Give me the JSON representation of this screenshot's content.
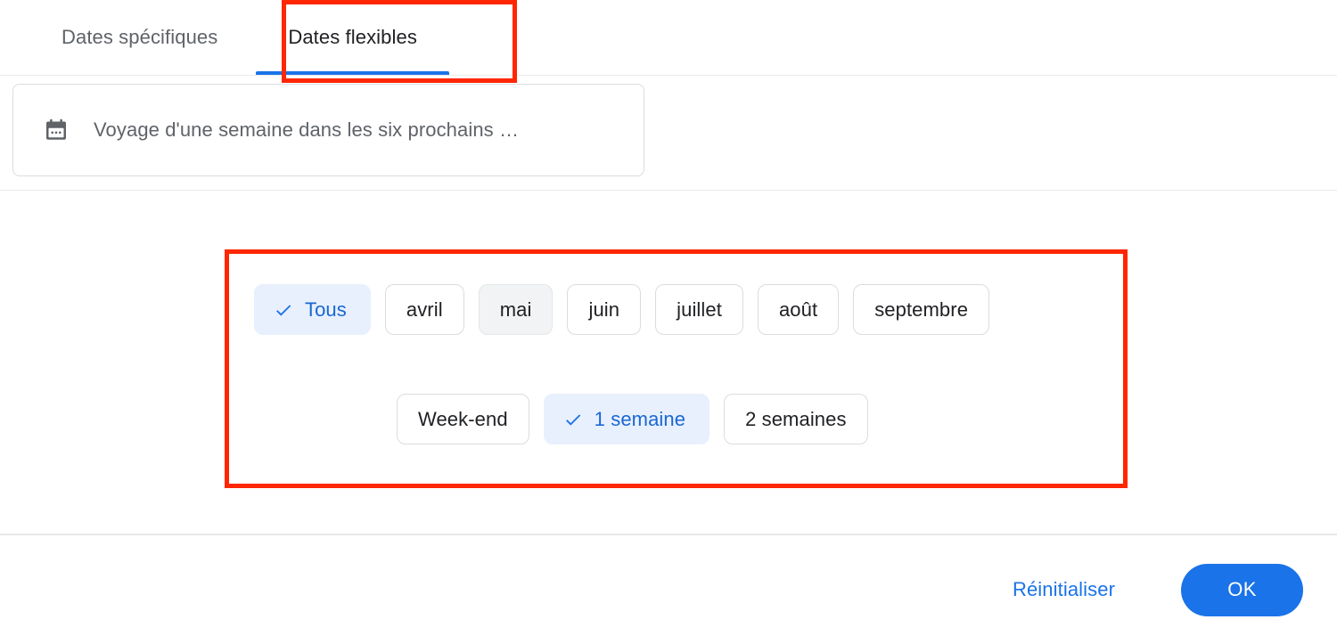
{
  "tabs": [
    {
      "label": "Dates spécifiques",
      "active": false
    },
    {
      "label": "Dates flexibles",
      "active": true
    }
  ],
  "search_field": {
    "icon": "calendar-icon",
    "value": "Voyage d'une semaine dans les six prochains …"
  },
  "options": {
    "months": [
      {
        "label": "Tous",
        "state": "selected"
      },
      {
        "label": "avril",
        "state": "default"
      },
      {
        "label": "mai",
        "state": "hovered"
      },
      {
        "label": "juin",
        "state": "default"
      },
      {
        "label": "juillet",
        "state": "default"
      },
      {
        "label": "août",
        "state": "default"
      },
      {
        "label": "septembre",
        "state": "default"
      }
    ],
    "durations": [
      {
        "label": "Week-end",
        "state": "default"
      },
      {
        "label": "1 semaine",
        "state": "selected"
      },
      {
        "label": "2 semaines",
        "state": "default"
      }
    ]
  },
  "footer": {
    "reset_label": "Réinitialiser",
    "ok_label": "OK"
  },
  "colors": {
    "accent_blue": "#1a73e8",
    "selected_chip_bg": "#e8f0fe",
    "selected_chip_text": "#1967d2",
    "hover_chip_bg": "#f1f3f4",
    "annotation_red": "#ff2600",
    "text_primary": "#202124",
    "text_secondary": "#5f6368",
    "border": "#dadce0"
  }
}
